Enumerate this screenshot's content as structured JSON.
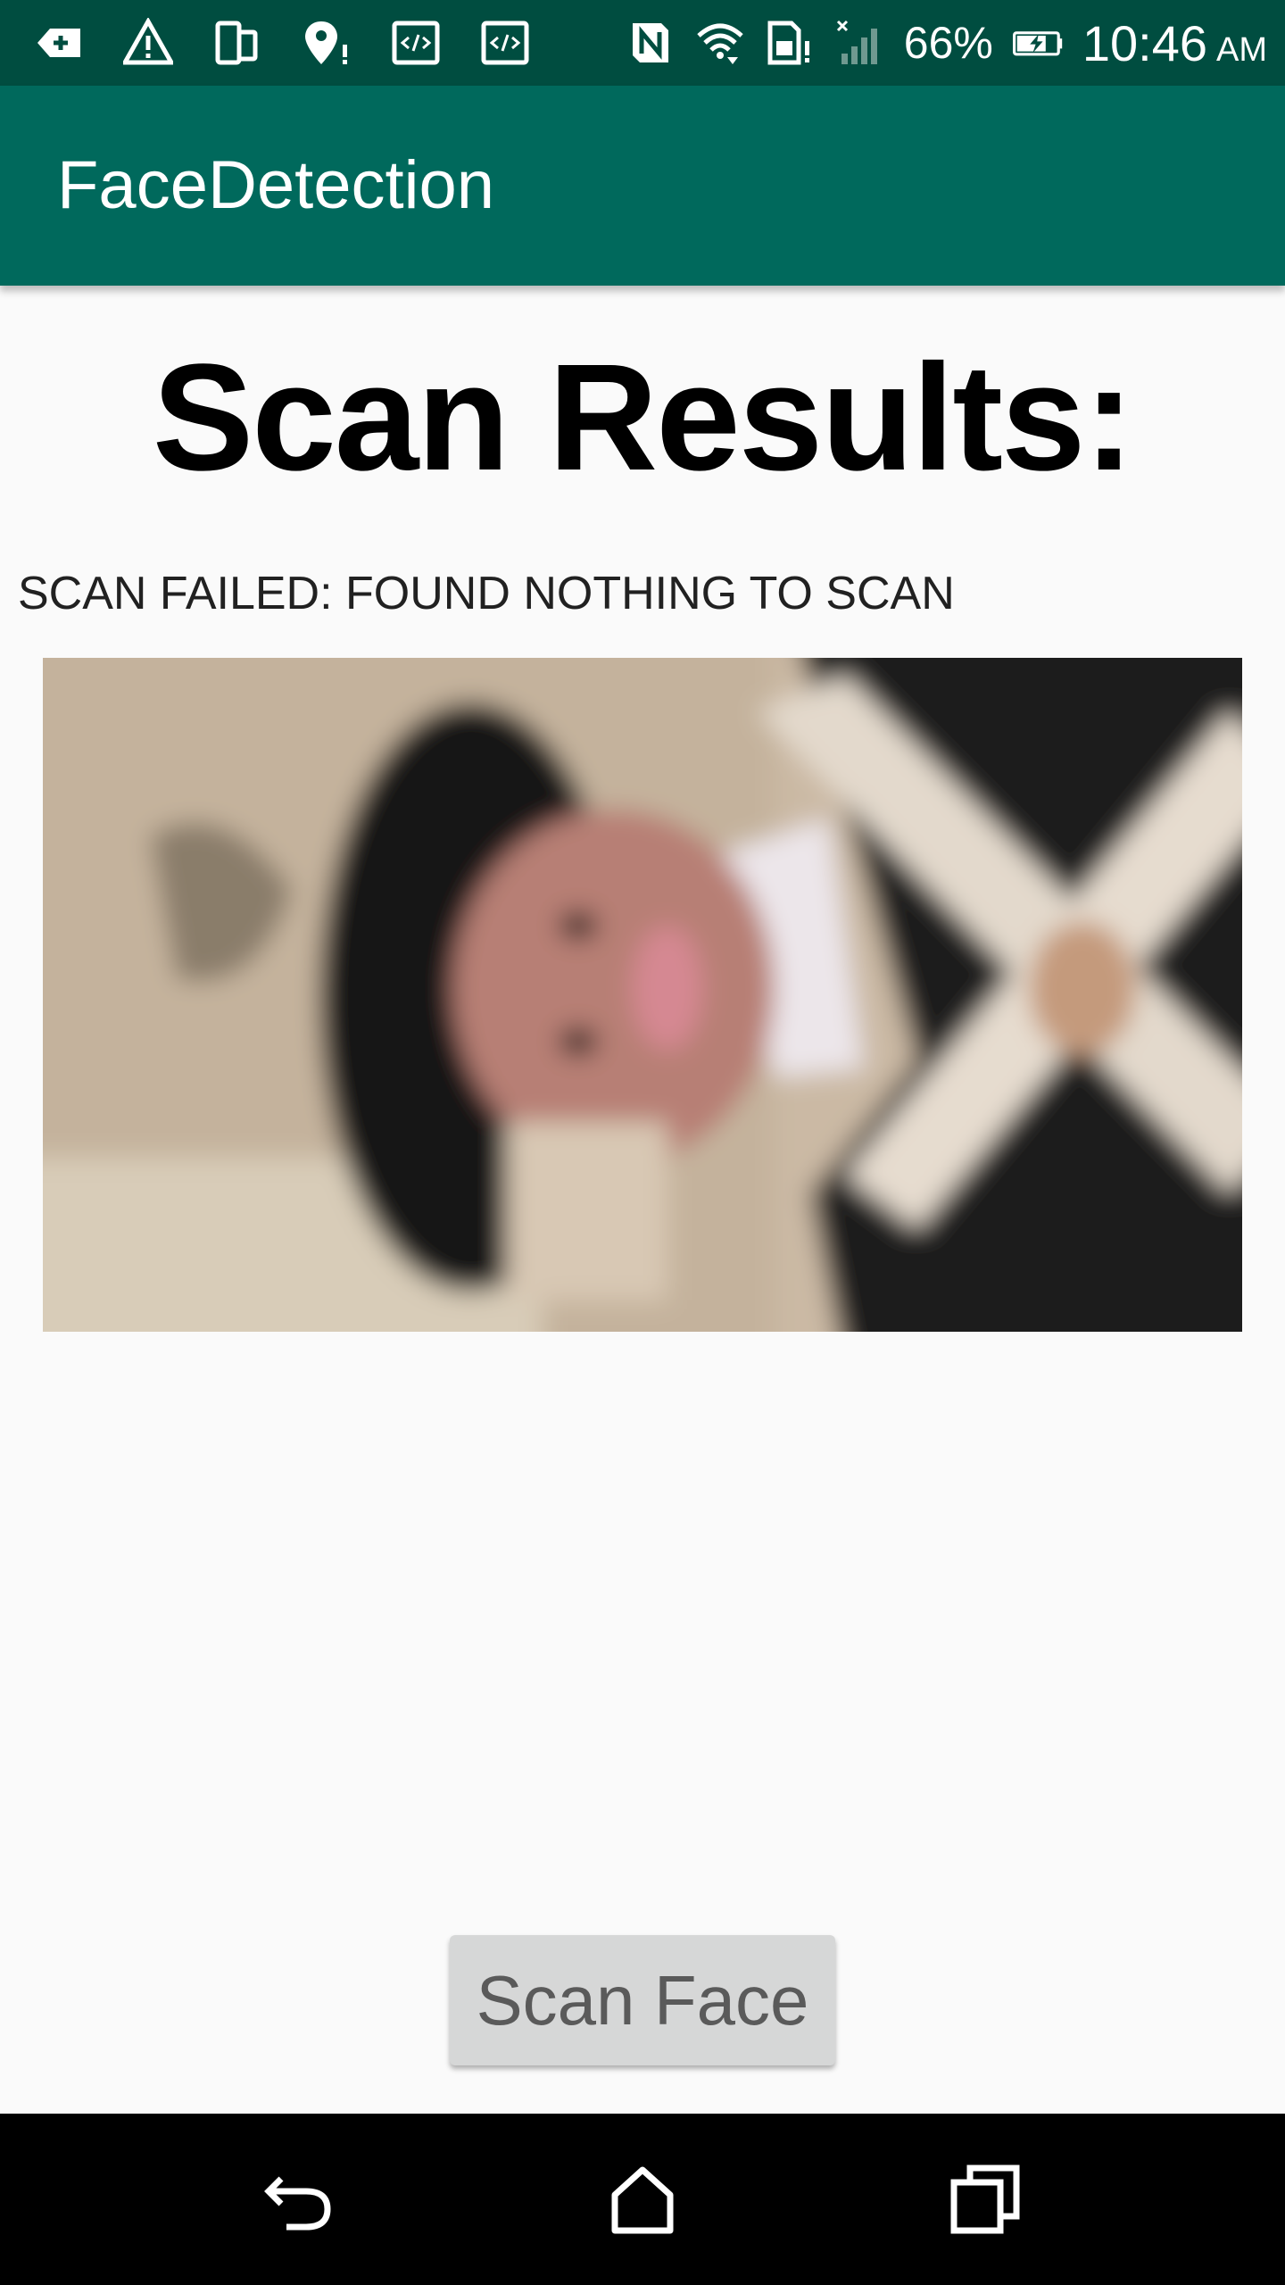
{
  "status_bar": {
    "battery_percent": "66%",
    "time": "10:46",
    "ampm": "AM",
    "icons": [
      "add-notification-icon",
      "warning-icon",
      "device-icon",
      "location-alert-icon",
      "code-icon",
      "code-icon",
      "nfc-icon",
      "wifi-icon",
      "sim-alert-icon",
      "signal-icon",
      "battery-charging-icon"
    ]
  },
  "app_bar": {
    "title": "FaceDetection"
  },
  "main": {
    "heading": "Scan Results:",
    "result_message": "SCAN FAILED: FOUND NOTHING TO SCAN",
    "scan_button_label": "Scan Face"
  },
  "nav_bar": {
    "icons": [
      "back-icon",
      "home-icon",
      "recents-icon"
    ]
  },
  "colors": {
    "status_bar": "#004d40",
    "app_bar": "#00695c",
    "background": "#fafafa",
    "button": "#d6d7d7",
    "nav_bar": "#000000"
  }
}
